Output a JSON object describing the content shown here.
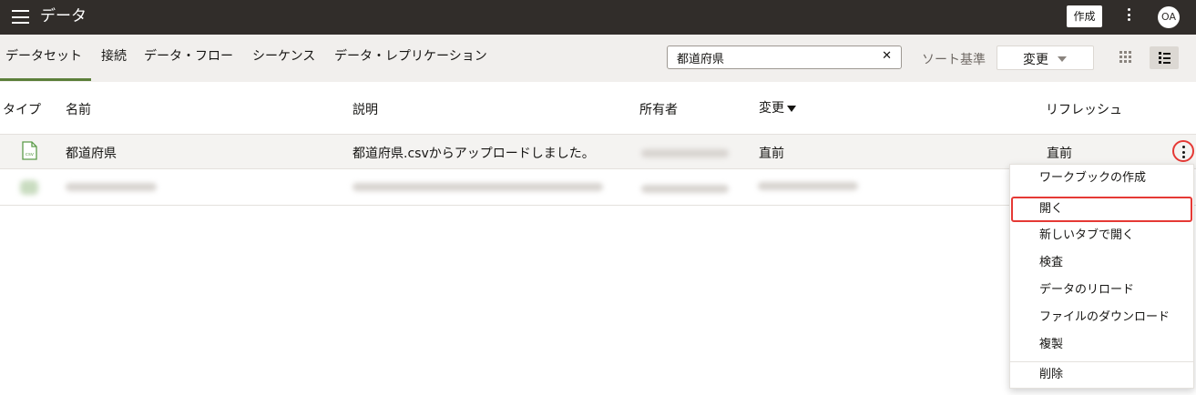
{
  "app": {
    "title": "データ",
    "create_label": "作成",
    "avatar_initials": "OA"
  },
  "tabs": [
    {
      "label": "データセット",
      "active": true
    },
    {
      "label": "接続"
    },
    {
      "label": "データ・フロー"
    },
    {
      "label": "シーケンス"
    },
    {
      "label": "データ・レプリケーション"
    }
  ],
  "search": {
    "value": "都道府県",
    "clear_glyph": "✕"
  },
  "sort": {
    "label": "ソート基準",
    "selected": "変更"
  },
  "table": {
    "columns": [
      "タイプ",
      "名前",
      "説明",
      "所有者",
      "変更",
      "リフレッシュ"
    ],
    "rows": [
      {
        "type_icon": "csv-file-icon",
        "type_icon_text": "csv",
        "name": "都道府県",
        "description": "都道府県.csvからアップロードしました。",
        "modified": "直前",
        "refresh": "直前"
      }
    ]
  },
  "context_menu": {
    "items": [
      {
        "label": "ワークブックの作成"
      },
      {
        "label": "開く",
        "highlighted": true
      },
      {
        "label": "新しいタブで開く"
      },
      {
        "label": "検査"
      },
      {
        "label": "データのリロード"
      },
      {
        "label": "ファイルのダウンロード"
      },
      {
        "label": "複製"
      },
      {
        "label": "削除"
      }
    ]
  },
  "colors": {
    "appbar": "#312d2a",
    "toolbar": "#f1efed",
    "accent_green": "#5c7f3a",
    "highlight_red": "#e53935"
  }
}
